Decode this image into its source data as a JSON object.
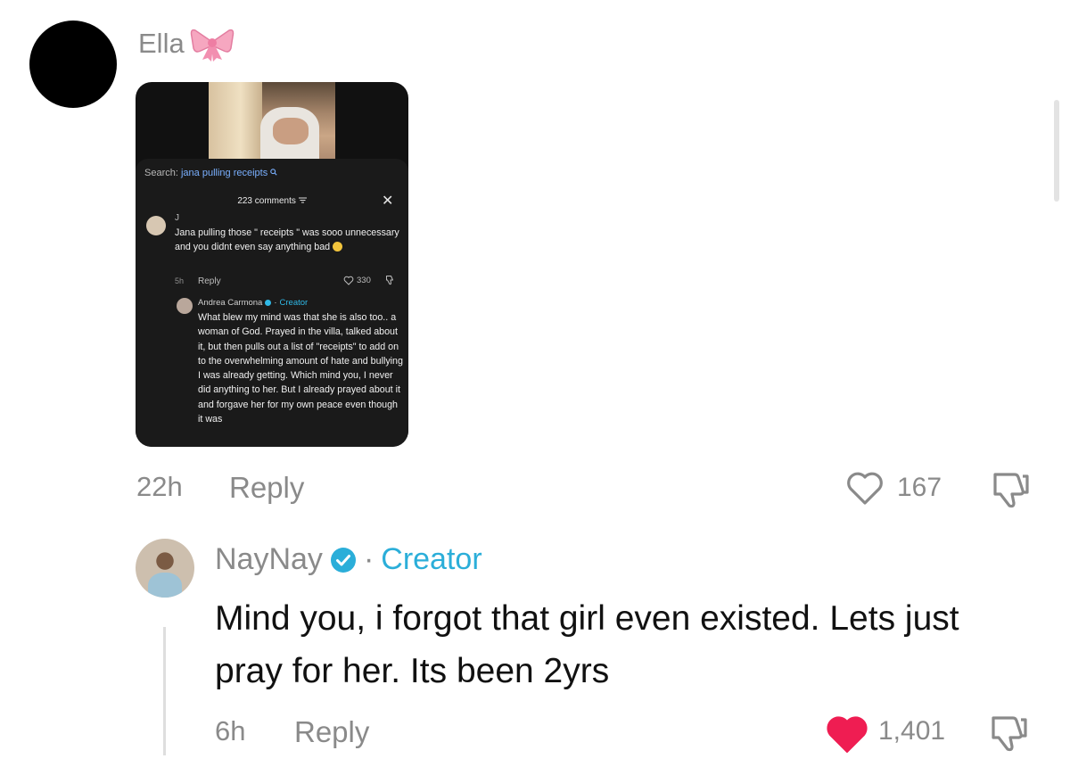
{
  "top_comment": {
    "username": "Ella",
    "time": "22h",
    "reply_label": "Reply",
    "likes": "167",
    "liked": false,
    "embedded_screenshot": {
      "search_label": "Search:",
      "search_query": "jana pulling receipts",
      "comments_header": "223 comments",
      "close_icon": "close-icon",
      "comment": {
        "username": "J",
        "text": "Jana pulling those \" receipts \" was sooo unnecessary and you didnt even say anything bad",
        "time": "5h",
        "reply_label": "Reply",
        "likes": "330"
      },
      "creator_reply": {
        "username": "Andrea Carmona",
        "role": "Creator",
        "text": "What blew my mind was that she is also too.. a woman of God. Prayed in the villa, talked about it, but then pulls out a list of \"receipts\" to add on to the overwhelming amount of hate and bullying I was already getting. Which mind you, I never did anything to her. But I already prayed about it and forgave her for my own peace even though it was"
      }
    }
  },
  "reply_comment": {
    "username": "NayNay",
    "separator": "·",
    "role": "Creator",
    "text": "Mind you, i forgot that girl even existed. Lets just pray for her. Its been 2yrs",
    "time": "6h",
    "reply_label": "Reply",
    "likes": "1,401",
    "liked": true
  },
  "colors": {
    "muted_text": "#8a8a8a",
    "creator_blue": "#2baed9",
    "like_red": "#ef1d52",
    "card_bg": "#111111"
  },
  "icons": [
    "bow-emoji-icon",
    "heart-outline-icon",
    "heart-filled-icon",
    "dislike-icon",
    "verified-badge-icon",
    "close-icon",
    "filter-icon",
    "search-icon"
  ]
}
